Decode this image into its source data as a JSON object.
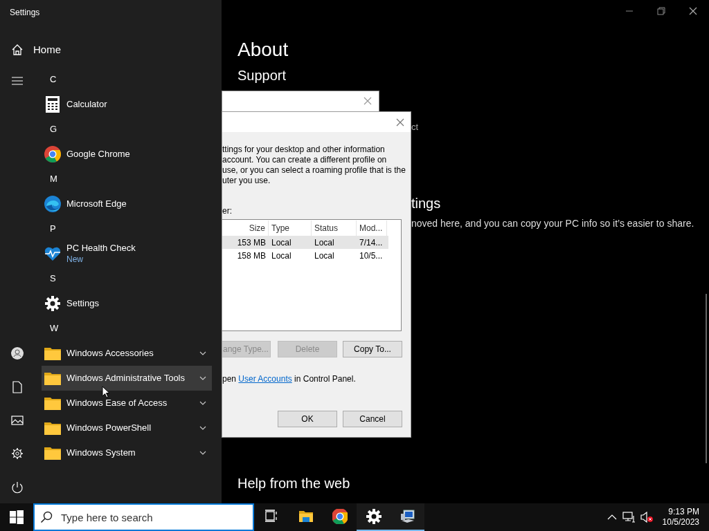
{
  "settings_window": {
    "title": "Settings",
    "page_title": "About",
    "section_support": "Support",
    "cut_text_1": "ct",
    "section_settings": "tings",
    "settings_text": "noved here, and you can copy your PC info so it’s easier to share.",
    "section_help": "Help from the web"
  },
  "start_menu": {
    "home": "Home",
    "groups": [
      {
        "letter": "C",
        "apps": [
          {
            "name": "Calculator",
            "kind": "calculator",
            "hovered": false,
            "expandable": false
          }
        ]
      },
      {
        "letter": "G",
        "apps": [
          {
            "name": "Google Chrome",
            "kind": "chrome",
            "hovered": false,
            "expandable": false
          }
        ]
      },
      {
        "letter": "M",
        "apps": [
          {
            "name": "Microsoft Edge",
            "kind": "edge",
            "hovered": false,
            "expandable": false
          }
        ]
      },
      {
        "letter": "P",
        "apps": [
          {
            "name": "PC Health Check",
            "badge": "New",
            "kind": "health",
            "hovered": false,
            "expandable": false
          }
        ]
      },
      {
        "letter": "S",
        "apps": [
          {
            "name": "Settings",
            "kind": "gear",
            "hovered": false,
            "expandable": false
          }
        ]
      },
      {
        "letter": "W",
        "apps": [
          {
            "name": "Windows Accessories",
            "kind": "folder",
            "hovered": false,
            "expandable": true
          },
          {
            "name": "Windows Administrative Tools",
            "kind": "folder",
            "hovered": true,
            "expandable": true
          },
          {
            "name": "Windows Ease of Access",
            "kind": "folder",
            "hovered": false,
            "expandable": true
          },
          {
            "name": "Windows PowerShell",
            "kind": "folder",
            "hovered": false,
            "expandable": true
          },
          {
            "name": "Windows System",
            "kind": "folder",
            "hovered": false,
            "expandable": true
          }
        ]
      }
    ]
  },
  "dialog": {
    "description_lines": [
      "ttings for your desktop and other information",
      "account. You can create a different profile on",
      "use, or you can select a roaming profile that is the",
      "uter you use."
    ],
    "list_label": "er:",
    "columns": [
      "Size",
      "Type",
      "Status",
      "Mod..."
    ],
    "rows": [
      {
        "cells": [
          "153 MB",
          "Local",
          "Local",
          "7/14..."
        ],
        "selected": true
      },
      {
        "cells": [
          "158 MB",
          "Local",
          "Local",
          "10/5..."
        ],
        "selected": false
      }
    ],
    "buttons": [
      {
        "label": "ange Type...",
        "disabled": true
      },
      {
        "label": "Delete",
        "disabled": true
      },
      {
        "label": "Copy To...",
        "disabled": false
      }
    ],
    "note_prefix": "pen",
    "note_link": "User Accounts",
    "note_suffix": "in Control Panel.",
    "ok": "OK",
    "cancel": "Cancel"
  },
  "taskbar": {
    "search_placeholder": "Type here to search",
    "pinned": [
      {
        "kind": "taskview",
        "active": false
      },
      {
        "kind": "explorer",
        "active": false
      },
      {
        "kind": "chrome",
        "active": false
      },
      {
        "kind": "gear",
        "active": true
      },
      {
        "kind": "computer",
        "active": true
      }
    ],
    "time": "9:13 PM",
    "date": "10/5/2023"
  }
}
